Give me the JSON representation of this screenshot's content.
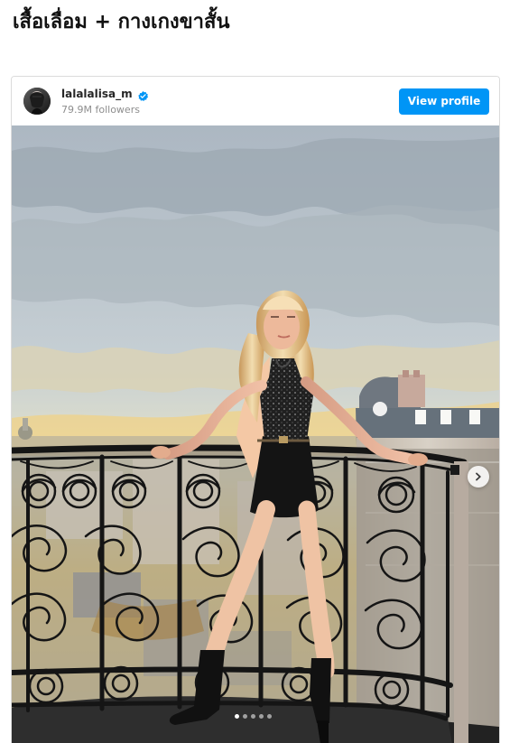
{
  "article": {
    "title": "เสื้อเลื่อม + กางเกงขาสั้น"
  },
  "instagram_embed": {
    "profile": {
      "username": "lalalalisa_m",
      "followers": "79.9M followers",
      "avatar_icon": "profile-avatar-icon",
      "verified_icon": "verified-badge-icon"
    },
    "actions": {
      "view_profile_label": "View profile"
    },
    "carousel": {
      "total_slides": 5,
      "active_slide": 1,
      "next_icon": "chevron-right-icon"
    },
    "colors": {
      "view_profile_button": "#0095f6",
      "verified_badge": "#0095f6",
      "username": "#262626",
      "followers": "#8e8e8e"
    }
  }
}
